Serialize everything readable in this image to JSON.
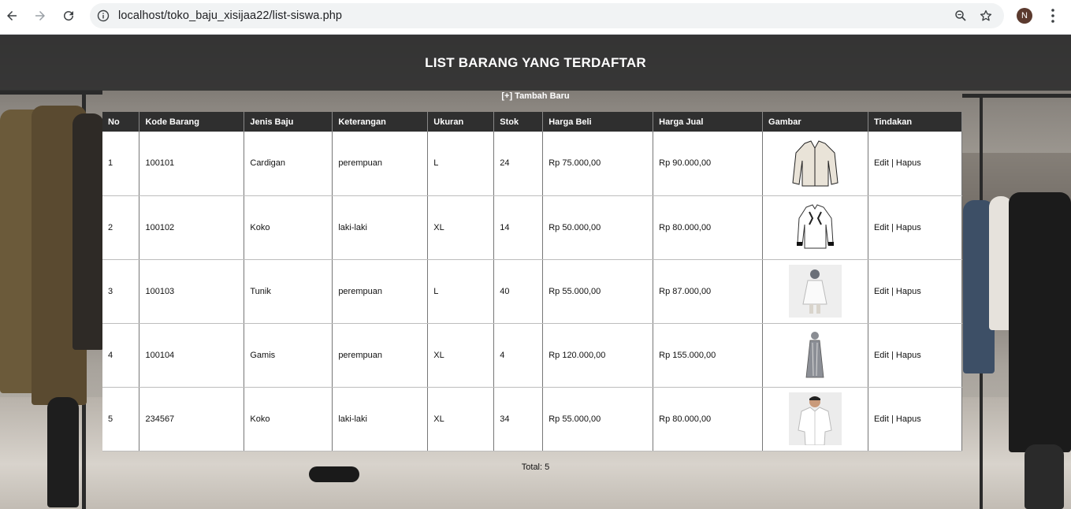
{
  "browser": {
    "url": "localhost/toko_baju_xisijaa22/list-siswa.php",
    "profile_initial": "N"
  },
  "page": {
    "title": "LIST BARANG YANG TERDAFTAR",
    "add_link": "[+] Tambah Baru",
    "total": "Total: 5"
  },
  "table": {
    "headers": [
      "No",
      "Kode Barang",
      "Jenis Baju",
      "Keterangan",
      "Ukuran",
      "Stok",
      "Harga Beli",
      "Harga Jual",
      "Gambar",
      "Tindakan"
    ],
    "edit_label": "Edit",
    "separator": " | ",
    "delete_label": "Hapus",
    "rows": [
      {
        "no": "1",
        "kode": "100101",
        "jenis": "Cardigan",
        "keterangan": "perempuan",
        "ukuran": "L",
        "stok": "24",
        "harga_beli": "Rp 75.000,00",
        "harga_jual": "Rp 90.000,00",
        "gambar": "cardigan-image"
      },
      {
        "no": "2",
        "kode": "100102",
        "jenis": "Koko",
        "keterangan": "laki-laki",
        "ukuran": "XL",
        "stok": "14",
        "harga_beli": "Rp 50.000,00",
        "harga_jual": "Rp 80.000,00",
        "gambar": "koko-shirt-image"
      },
      {
        "no": "3",
        "kode": "100103",
        "jenis": "Tunik",
        "keterangan": "perempuan",
        "ukuran": "L",
        "stok": "40",
        "harga_beli": "Rp 55.000,00",
        "harga_jual": "Rp 87.000,00",
        "gambar": "tunik-image"
      },
      {
        "no": "4",
        "kode": "100104",
        "jenis": "Gamis",
        "keterangan": "perempuan",
        "ukuran": "XL",
        "stok": "4",
        "harga_beli": "Rp 120.000,00",
        "harga_jual": "Rp 155.000,00",
        "gambar": "gamis-image"
      },
      {
        "no": "5",
        "kode": "234567",
        "jenis": "Koko",
        "keterangan": "laki-laki",
        "ukuran": "XL",
        "stok": "34",
        "harga_beli": "Rp 55.000,00",
        "harga_jual": "Rp 80.000,00",
        "gambar": "koko-model-image"
      }
    ]
  }
}
